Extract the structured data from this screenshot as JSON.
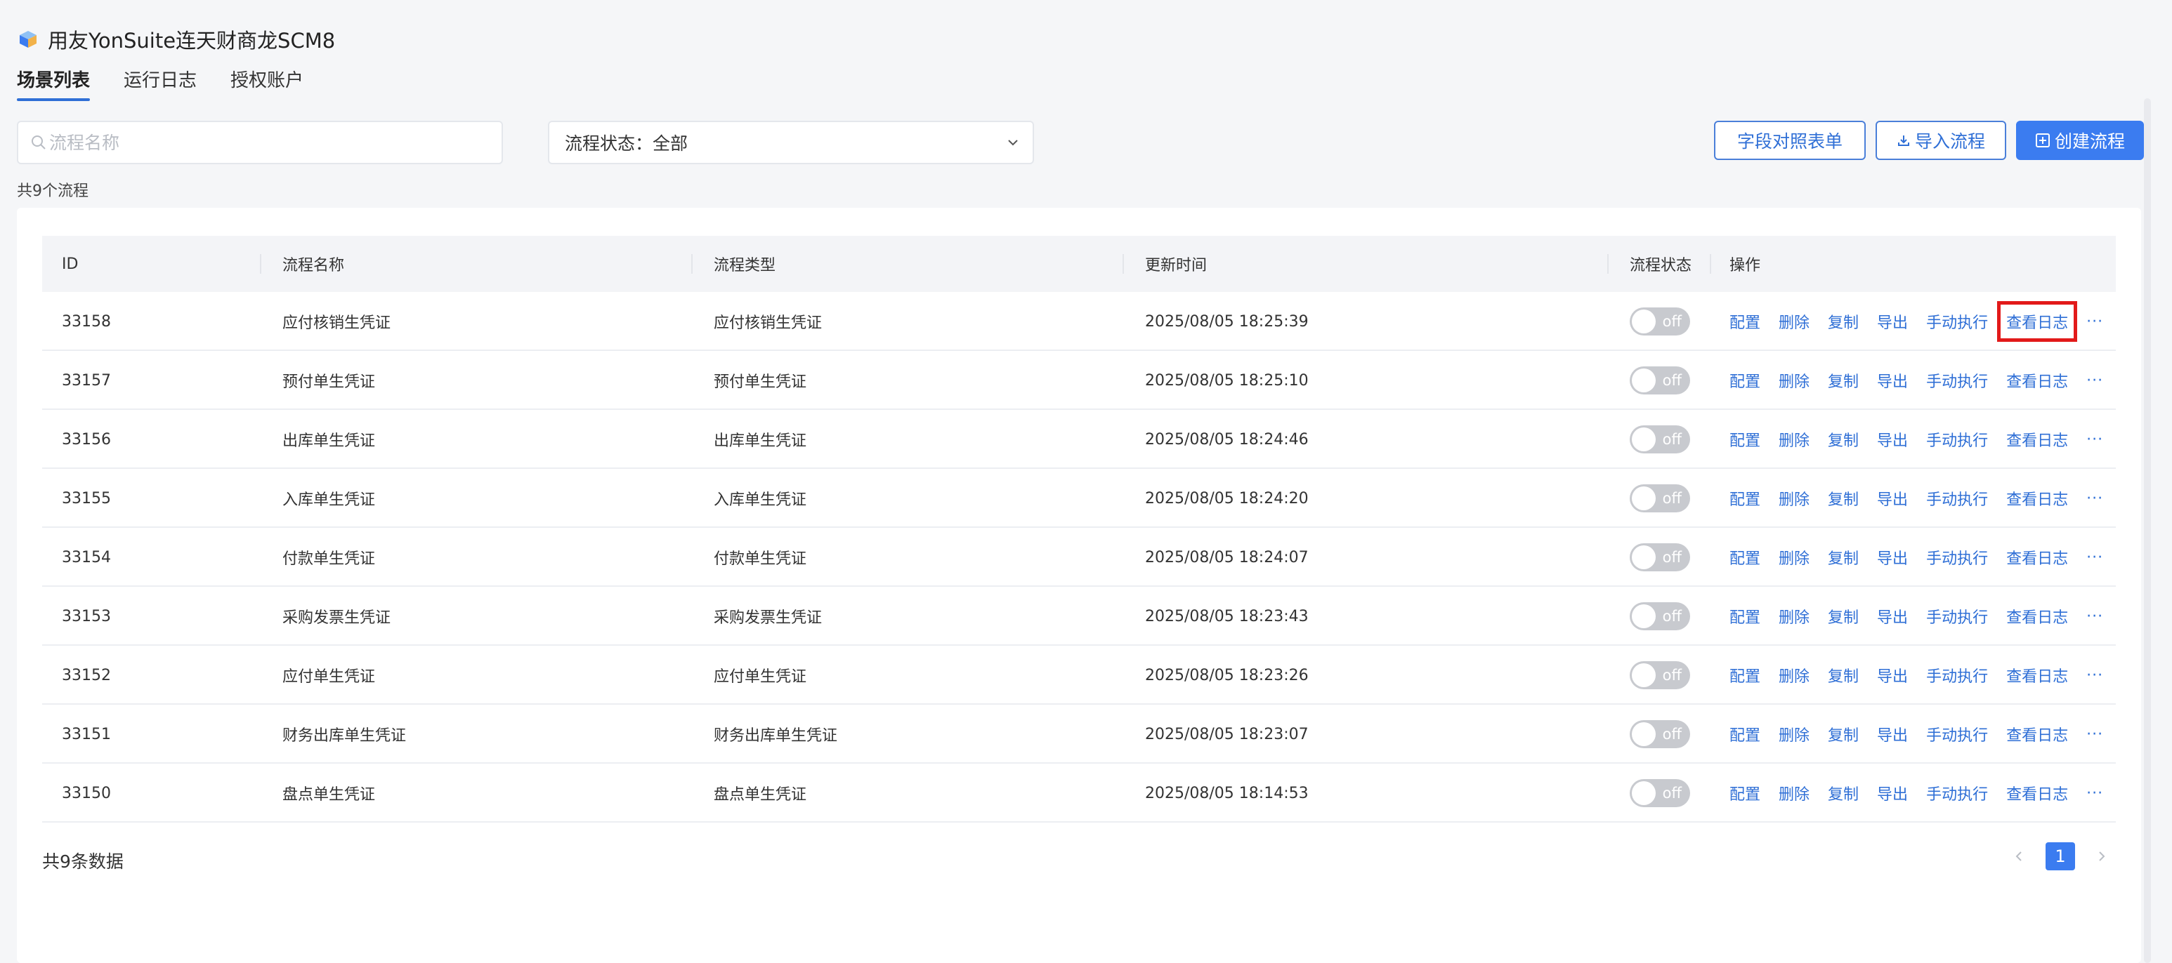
{
  "app": {
    "title": "用友YonSuite连天财商龙SCM8"
  },
  "tabs": [
    {
      "label": "场景列表",
      "active": true
    },
    {
      "label": "运行日志",
      "active": false
    },
    {
      "label": "授权账户",
      "active": false
    }
  ],
  "search": {
    "placeholder": "流程名称",
    "value": ""
  },
  "status_filter": {
    "label": "流程状态：",
    "value": "全部"
  },
  "toolbar": {
    "field_map_label": "字段对照表单",
    "import_label": "导入流程",
    "create_label": "创建流程"
  },
  "summary": {
    "flow_count_text": "共9个流程"
  },
  "table": {
    "headers": [
      "ID",
      "流程名称",
      "流程类型",
      "更新时间",
      "流程状态",
      "操作"
    ],
    "toggle_off_label": "off",
    "ops": [
      "配置",
      "删除",
      "复制",
      "导出",
      "手动执行",
      "查看日志"
    ],
    "more_label": "···",
    "rows": [
      {
        "id": "33158",
        "name": "应付核销生凭证",
        "type": "应付核销生凭证",
        "updated": "2025/08/05 18:25:39",
        "status": "off"
      },
      {
        "id": "33157",
        "name": "预付单生凭证",
        "type": "预付单生凭证",
        "updated": "2025/08/05 18:25:10",
        "status": "off"
      },
      {
        "id": "33156",
        "name": "出库单生凭证",
        "type": "出库单生凭证",
        "updated": "2025/08/05 18:24:46",
        "status": "off"
      },
      {
        "id": "33155",
        "name": "入库单生凭证",
        "type": "入库单生凭证",
        "updated": "2025/08/05 18:24:20",
        "status": "off"
      },
      {
        "id": "33154",
        "name": "付款单生凭证",
        "type": "付款单生凭证",
        "updated": "2025/08/05 18:24:07",
        "status": "off"
      },
      {
        "id": "33153",
        "name": "采购发票生凭证",
        "type": "采购发票生凭证",
        "updated": "2025/08/05 18:23:43",
        "status": "off"
      },
      {
        "id": "33152",
        "name": "应付单生凭证",
        "type": "应付单生凭证",
        "updated": "2025/08/05 18:23:26",
        "status": "off"
      },
      {
        "id": "33151",
        "name": "财务出库单生凭证",
        "type": "财务出库单生凭证",
        "updated": "2025/08/05 18:23:07",
        "status": "off"
      },
      {
        "id": "33150",
        "name": "盘点单生凭证",
        "type": "盘点单生凭证",
        "updated": "2025/08/05 18:14:53",
        "status": "off"
      }
    ]
  },
  "footer": {
    "total_text": "共9条数据",
    "current_page": "1"
  },
  "colors": {
    "accent": "#3b7cf0",
    "link": "#2f6fd6",
    "highlight": "#e21a1a",
    "toggle_off": "#c8cacf"
  }
}
